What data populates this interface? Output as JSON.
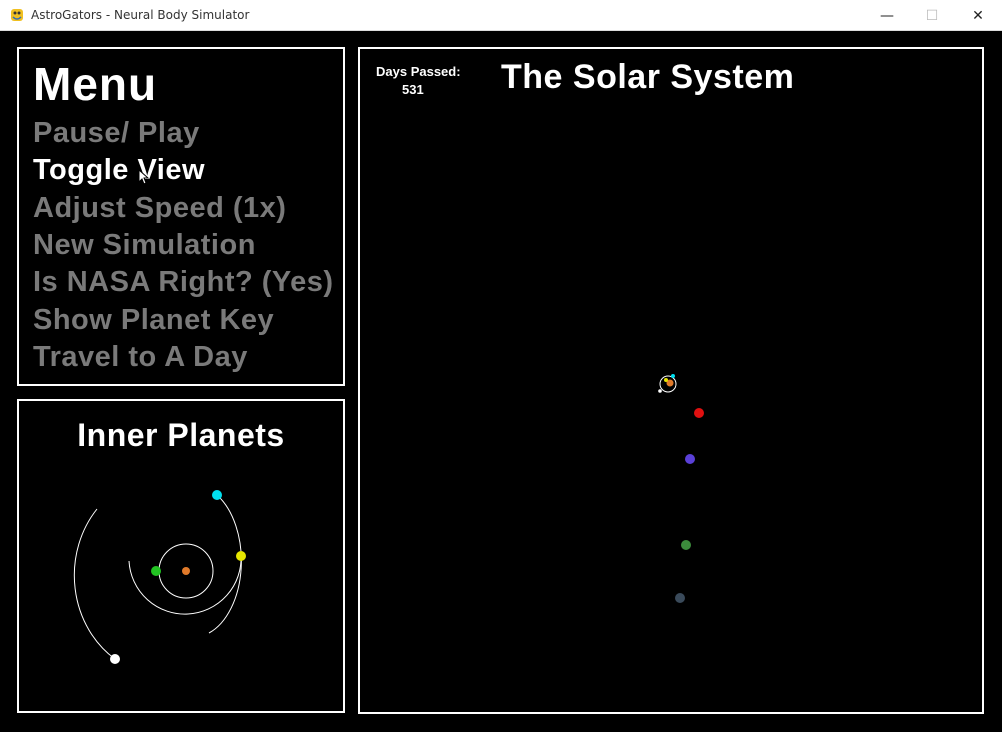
{
  "window": {
    "title": "AstroGators - Neural Body Simulator",
    "minimize_glyph": "—",
    "maximize_glyph": "☐",
    "close_glyph": "✕"
  },
  "menu": {
    "title": "Menu",
    "items": [
      {
        "label": "Pause/ Play",
        "active": false
      },
      {
        "label": "Toggle View",
        "active": true
      },
      {
        "label": "Adjust Speed (1x)",
        "active": false
      },
      {
        "label": "New Simulation",
        "active": false
      },
      {
        "label": "Is NASA Right? (Yes)",
        "active": false
      },
      {
        "label": "Show Planet Key",
        "active": false
      },
      {
        "label": "Travel to A Day",
        "active": false
      }
    ]
  },
  "inner_planets": {
    "title": "Inner Planets",
    "sun_color": "#e07a2a",
    "planet_colors": [
      "#22c322",
      "#e6e600",
      "#00e0f0",
      "#ffffff"
    ]
  },
  "solar_system": {
    "title": "The Solar System",
    "days_passed_label": "Days Passed:",
    "days_passed_value": "531",
    "planet_colors": [
      "#e01010",
      "#5a40d8",
      "#3c8c3c",
      "#3a4a5a"
    ]
  },
  "colors": {
    "background": "#000000",
    "border": "#ffffff",
    "menu_active": "#ffffff",
    "menu_inactive": "#7a7a7a"
  }
}
